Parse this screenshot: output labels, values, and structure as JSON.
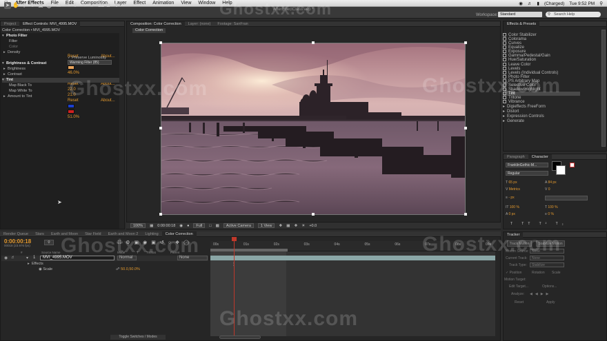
{
  "menubar": {
    "apple": "",
    "app_name": "After Effects",
    "items": [
      "File",
      "Edit",
      "Composition",
      "Layer",
      "Effect",
      "Animation",
      "View",
      "Window",
      "Help"
    ],
    "battery": "(Charged)",
    "clock": "Tue 9:52 PM"
  },
  "window_title": "AfterEffectClass.aep *",
  "workspace": {
    "label": "Workspace:",
    "value": "Standard"
  },
  "search_help": "Search Help",
  "project_panel": {
    "tabs": [
      "Project",
      "Effect Controls: MVI_4995.MOV"
    ],
    "header": "Color Correction • MVI_4995.MOV",
    "effects": [
      {
        "name": "Photo Filter",
        "reset": "Reset",
        "about": "About...",
        "props": [
          {
            "label": "Filter",
            "value": "Warming Filter (85)"
          },
          {
            "label": "Color",
            "value": ""
          },
          {
            "label": "Density",
            "value": "46.0%"
          },
          {
            "label": "",
            "value": "Preserve Luminosity"
          }
        ]
      },
      {
        "name": "Brightness & Contrast",
        "reset": "Reset",
        "about": "About...",
        "props": [
          {
            "label": "Brightness",
            "value": "22.0"
          },
          {
            "label": "Contrast",
            "value": "21.0"
          }
        ]
      },
      {
        "name": "Tint",
        "reset": "Reset",
        "about": "About...",
        "props": [
          {
            "label": "Map Black To",
            "value": ""
          },
          {
            "label": "Map White To",
            "value": ""
          },
          {
            "label": "Amount to Tint",
            "value": "51.0%"
          }
        ]
      }
    ]
  },
  "comp_panel": {
    "tabs": [
      "Composition: Color Correction",
      "Layer: (none)",
      "Footage: SanFran"
    ],
    "breadcrumb": "Color Correction",
    "bottom_bar": {
      "zoom": "100%",
      "timecode": "0:00:00:18",
      "resolution": "Full",
      "camera": "Active Camera",
      "view": "1 View",
      "exposure": "+0.0"
    }
  },
  "effects_presets": {
    "title": "Effects & Presets",
    "items": [
      "Color Stabilizer",
      "Colorama",
      "Curves",
      "Equalize",
      "Exposure",
      "Gamma/Pedestal/Gain",
      "Hue/Saturation",
      "Leave Color",
      "Levels",
      "Levels (Individual Controls)",
      "Photo Filter",
      "PS Arbitrary Map",
      "Selective Color",
      "Shadow/Highlight",
      "Tint",
      "Tritone",
      "Vibrance"
    ],
    "groups": [
      "Digieffects FreeForm",
      "Distort",
      "Expression Controls",
      "Generate"
    ],
    "highlight_item": "Tint"
  },
  "character_panel": {
    "tabs": [
      "Paragraph",
      "Character"
    ],
    "font": "FranklinGothic-M...",
    "style": "Regular",
    "size": "65 px",
    "leading": "84 px",
    "kerning": "Metrics",
    "tracking": "0",
    "stroke": "- px",
    "stroke_mode": "",
    "vscale": "100 %",
    "hscale": "100 %",
    "baseline": "0 px",
    "tsume": "0 %"
  },
  "timeline": {
    "tabs": [
      "Render Queue",
      "Stars",
      "Earth and Moon",
      "Star Field",
      "Earth and Moon 2",
      "Lighting",
      "Color Correction"
    ],
    "active_tab": "Color Correction",
    "timecode": "0:00:00:18",
    "subtimecode": "00018 (23.976 fps)",
    "columns": [
      "#",
      "Source Name",
      "Mode",
      "T",
      "TrkMat",
      "Parent"
    ],
    "layer": {
      "number": "1",
      "name": "MVI_4995.MOV",
      "mode": "Normal",
      "parent": "None"
    },
    "subrows": [
      "Effects",
      "Scale"
    ],
    "scale_value": "50.0,50.0%",
    "ruler_ticks": [
      "00s",
      "01s",
      "02s",
      "03s",
      "04s",
      "05s",
      "06s",
      "07s",
      "08s",
      "09s"
    ],
    "toggle_label": "Toggle Switches / Modes"
  },
  "tracker": {
    "title": "Tracker",
    "buttons": [
      "Track Motion",
      "Stabilize Motion"
    ],
    "fields": [
      {
        "label": "Motion Source:",
        "value": "None"
      },
      {
        "label": "Current Track:",
        "value": "None"
      },
      {
        "label": "Track Type:",
        "value": "Stabilize"
      }
    ],
    "options": [
      "Position",
      "Rotation",
      "Scale"
    ],
    "motion_target": "Motion Target:",
    "edit_target": "Edit Target...",
    "options_btn": "Options...",
    "analyze": "Analyze:",
    "reset": "Reset",
    "apply": "Apply"
  },
  "watermark": "Ghostxx.com",
  "colors": {
    "accent": "#e59a2e",
    "panel": "#262626",
    "sky_top": "#c9a8b0",
    "water": "#5b4655"
  }
}
